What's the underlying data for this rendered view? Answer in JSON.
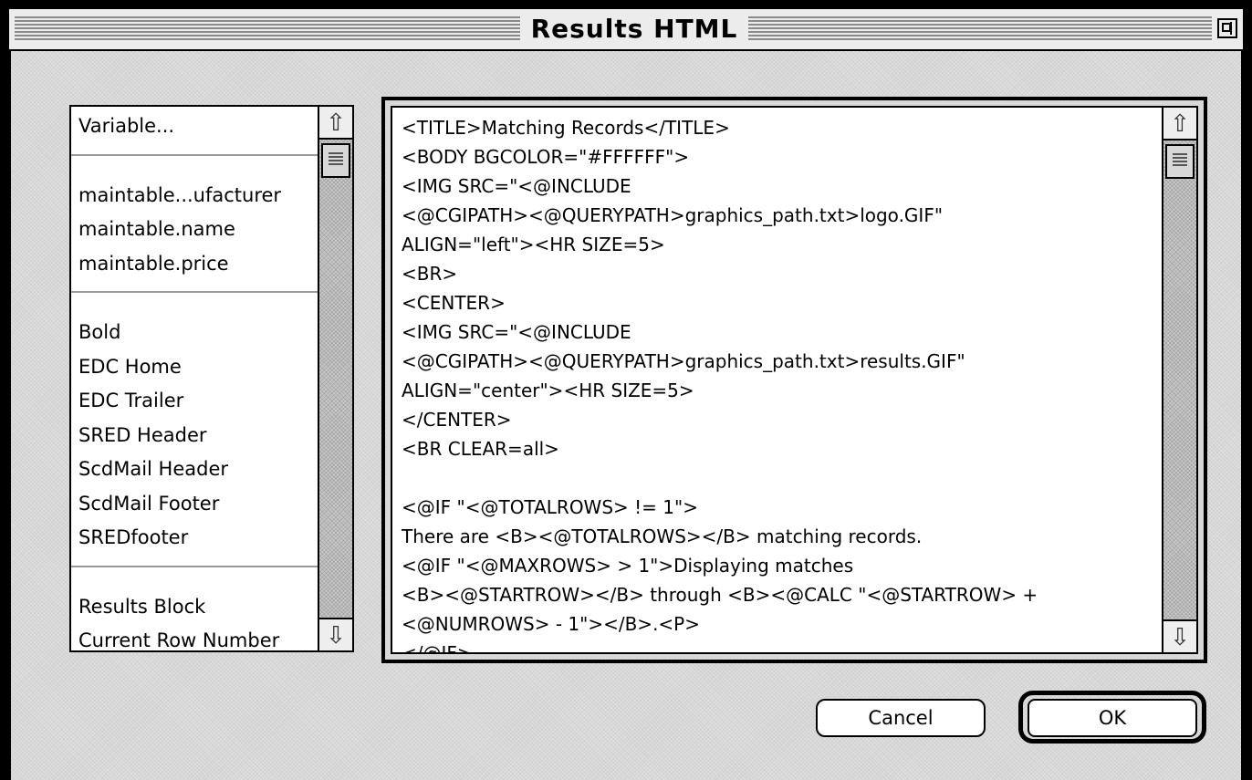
{
  "window": {
    "title": "Results HTML"
  },
  "variables_list": {
    "groups": [
      [
        "Variable..."
      ],
      [
        "maintable...ufacturer",
        "maintable.name",
        "maintable.price"
      ],
      [
        "Bold",
        "EDC Home",
        "EDC Trailer",
        "SRED Header",
        "ScdMail Header",
        "ScdMail Footer",
        "SREDfooter"
      ],
      [
        "Results Block",
        "Current Row Number"
      ]
    ]
  },
  "editor": {
    "lines": [
      "<TITLE>Matching Records</TITLE>",
      "<BODY BGCOLOR=\"#FFFFFF\">",
      "<IMG SRC=\"<@INCLUDE",
      "<@CGIPATH><@QUERYPATH>graphics_path.txt>logo.GIF\"",
      "ALIGN=\"left\"><HR SIZE=5>",
      "<BR>",
      "<CENTER>",
      "<IMG SRC=\"<@INCLUDE",
      "<@CGIPATH><@QUERYPATH>graphics_path.txt>results.GIF\"",
      "ALIGN=\"center\"><HR SIZE=5>",
      "</CENTER>",
      "<BR CLEAR=all>",
      "",
      "<@IF \"<@TOTALROWS> != 1\">",
      "There are <B><@TOTALROWS></B> matching records.",
      "<@IF \"<@MAXROWS> > 1\">Displaying matches",
      "<B><@STARTROW></B> through <B><@CALC \"<@STARTROW> +",
      "<@NUMROWS> - 1\"></B>.<P>",
      "</@IF>"
    ]
  },
  "buttons": {
    "cancel": "Cancel",
    "ok": "OK"
  },
  "icons": {
    "zoom": "zoom-box-icon",
    "scroll_up": "scroll-up-arrow-icon",
    "scroll_down": "scroll-down-arrow-icon"
  }
}
